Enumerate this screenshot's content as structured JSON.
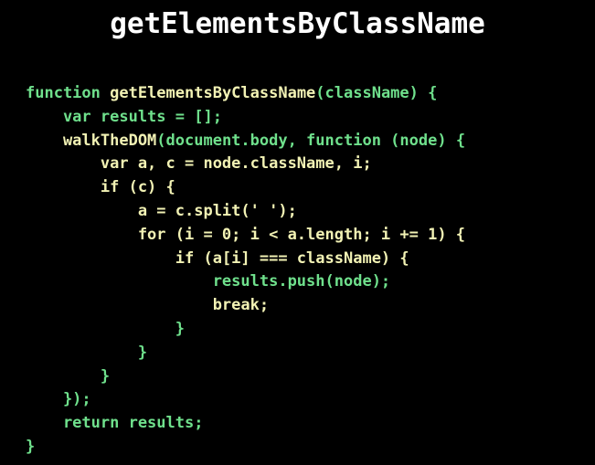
{
  "slide": {
    "title": "getElementsByClassName",
    "colors": {
      "background": "#000000",
      "title": "#ffffff",
      "code_green": "#6fe08c",
      "code_yellow": "#f2f2b4"
    },
    "code_lines": [
      [
        {
          "text": "function ",
          "color": "green"
        },
        {
          "text": "getElementsByClassName",
          "color": "yellow"
        },
        {
          "text": "(className) {",
          "color": "green"
        }
      ],
      [
        {
          "text": "    var results = [];",
          "color": "green"
        }
      ],
      [
        {
          "text": "    walkTheDOM",
          "color": "yellow"
        },
        {
          "text": "(document.body, function (node) {",
          "color": "green"
        }
      ],
      [
        {
          "text": "        var a, c = node.className, i;",
          "color": "yellow"
        }
      ],
      [
        {
          "text": "        if (c) {",
          "color": "yellow"
        }
      ],
      [
        {
          "text": "            a = c.split(' ');",
          "color": "yellow"
        }
      ],
      [
        {
          "text": "            for (i = 0; i < a.length; i += 1) {",
          "color": "yellow"
        }
      ],
      [
        {
          "text": "                if (a[i] === className) {",
          "color": "yellow"
        }
      ],
      [
        {
          "text": "                    results.push(node);",
          "color": "green"
        }
      ],
      [
        {
          "text": "                    break;",
          "color": "yellow"
        }
      ],
      [
        {
          "text": "                }",
          "color": "green"
        }
      ],
      [
        {
          "text": "            }",
          "color": "green"
        }
      ],
      [
        {
          "text": "        }",
          "color": "green"
        }
      ],
      [
        {
          "text": "    });",
          "color": "green"
        }
      ],
      [
        {
          "text": "    return results;",
          "color": "green"
        }
      ],
      [
        {
          "text": "}",
          "color": "green"
        }
      ]
    ]
  }
}
